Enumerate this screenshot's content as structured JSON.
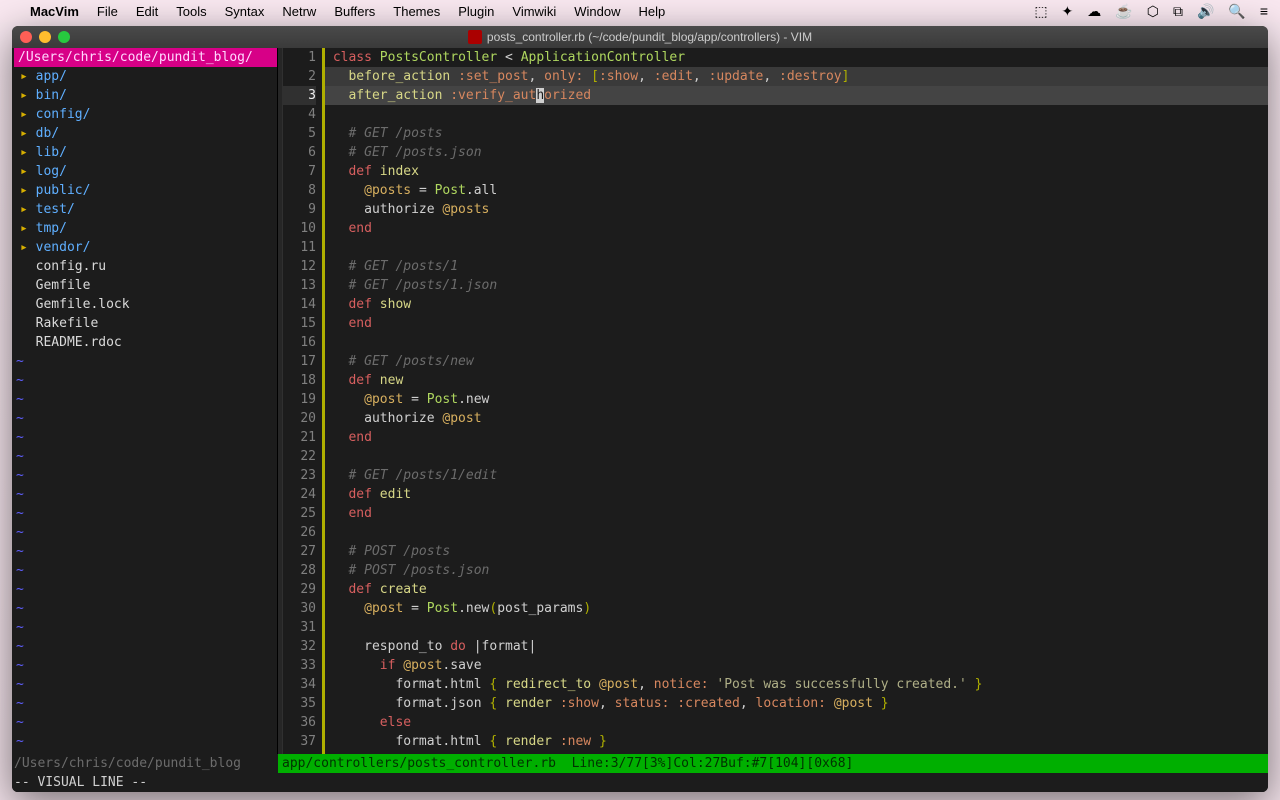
{
  "menubar": {
    "app": "MacVim",
    "items": [
      "File",
      "Edit",
      "Tools",
      "Syntax",
      "Netrw",
      "Buffers",
      "Themes",
      "Plugin",
      "Vimwiki",
      "Window",
      "Help"
    ]
  },
  "window": {
    "title": "posts_controller.rb (~/code/pundit_blog/app/controllers) - VIM"
  },
  "sidebar": {
    "path": "/Users/chris/code/pundit_blog/",
    "dirs": [
      "app/",
      "bin/",
      "config/",
      "db/",
      "lib/",
      "log/",
      "public/",
      "test/",
      "tmp/",
      "vendor/"
    ],
    "files": [
      "config.ru",
      "Gemfile",
      "Gemfile.lock",
      "Rakefile",
      "README.rdoc"
    ]
  },
  "code": {
    "cursor_line": 3,
    "lines": [
      {
        "n": 1,
        "html": " <span class='kw'>class</span> <span class='const'>PostsController</span> <span class='punc'>&lt;</span> <span class='const'>ApplicationController</span>"
      },
      {
        "n": 2,
        "sel": true,
        "html": "   <span class='fn'>before_action</span> <span class='sym'>:set_post</span><span class='punc'>,</span> <span class='sym'>only:</span> <span class='br'>[</span><span class='sym'>:show</span><span class='punc'>,</span> <span class='sym'>:edit</span><span class='punc'>,</span> <span class='sym'>:update</span><span class='punc'>,</span> <span class='sym'>:destroy</span><span class='br'>]</span>"
      },
      {
        "n": 3,
        "sel": true,
        "cur": true,
        "html": "   <span class='fn'>after_action</span> <span class='sym'>:verify_aut<span class='cursor-block'>h</span>orized</span>"
      },
      {
        "n": 4,
        "html": ""
      },
      {
        "n": 5,
        "html": "   <span class='cmt'># GET /posts</span>"
      },
      {
        "n": 6,
        "html": "   <span class='cmt'># GET /posts.json</span>"
      },
      {
        "n": 7,
        "html": "   <span class='kw'>def</span> <span class='fn'>index</span>"
      },
      {
        "n": 8,
        "html": "     <span class='ivar'>@posts</span> <span class='punc'>=</span> <span class='const'>Post</span><span class='punc'>.</span>all"
      },
      {
        "n": 9,
        "html": "     authorize <span class='ivar'>@posts</span>"
      },
      {
        "n": 10,
        "html": "   <span class='kw'>end</span>"
      },
      {
        "n": 11,
        "html": ""
      },
      {
        "n": 12,
        "html": "   <span class='cmt'># GET /posts/1</span>"
      },
      {
        "n": 13,
        "html": "   <span class='cmt'># GET /posts/1.json</span>"
      },
      {
        "n": 14,
        "html": "   <span class='kw'>def</span> <span class='fn'>show</span>"
      },
      {
        "n": 15,
        "html": "   <span class='kw'>end</span>"
      },
      {
        "n": 16,
        "html": ""
      },
      {
        "n": 17,
        "html": "   <span class='cmt'># GET /posts/new</span>"
      },
      {
        "n": 18,
        "html": "   <span class='kw'>def</span> <span class='fn'>new</span>"
      },
      {
        "n": 19,
        "html": "     <span class='ivar'>@post</span> <span class='punc'>=</span> <span class='const'>Post</span><span class='punc'>.</span>new"
      },
      {
        "n": 20,
        "html": "     authorize <span class='ivar'>@post</span>"
      },
      {
        "n": 21,
        "html": "   <span class='kw'>end</span>"
      },
      {
        "n": 22,
        "html": ""
      },
      {
        "n": 23,
        "html": "   <span class='cmt'># GET /posts/1/edit</span>"
      },
      {
        "n": 24,
        "html": "   <span class='kw'>def</span> <span class='fn'>edit</span>"
      },
      {
        "n": 25,
        "html": "   <span class='kw'>end</span>"
      },
      {
        "n": 26,
        "html": ""
      },
      {
        "n": 27,
        "html": "   <span class='cmt'># POST /posts</span>"
      },
      {
        "n": 28,
        "html": "   <span class='cmt'># POST /posts.json</span>"
      },
      {
        "n": 29,
        "html": "   <span class='kw'>def</span> <span class='fn'>create</span>"
      },
      {
        "n": 30,
        "html": "     <span class='ivar'>@post</span> <span class='punc'>=</span> <span class='const'>Post</span><span class='punc'>.</span>new<span class='br'>(</span>post_params<span class='br'>)</span>"
      },
      {
        "n": 31,
        "html": ""
      },
      {
        "n": 32,
        "html": "     respond_to <span class='kw'>do</span> <span class='punc'>|</span>format<span class='punc'>|</span>"
      },
      {
        "n": 33,
        "html": "       <span class='kw'>if</span> <span class='ivar'>@post</span><span class='punc'>.</span>save"
      },
      {
        "n": 34,
        "html": "         format<span class='punc'>.</span>html <span class='br'>{</span> <span class='fn'>redirect_to</span> <span class='ivar'>@post</span><span class='punc'>,</span> <span class='sym'>notice:</span> <span class='str'>'Post was successfully created.'</span> <span class='br'>}</span>"
      },
      {
        "n": 35,
        "html": "         format<span class='punc'>.</span>json <span class='br'>{</span> <span class='fn'>render</span> <span class='sym'>:show</span><span class='punc'>,</span> <span class='sym'>status:</span> <span class='sym'>:created</span><span class='punc'>,</span> <span class='sym'>location:</span> <span class='ivar'>@post</span> <span class='br'>}</span>"
      },
      {
        "n": 36,
        "html": "       <span class='kw'>else</span>"
      },
      {
        "n": 37,
        "html": "         format<span class='punc'>.</span>html <span class='br'>{</span> <span class='fn'>render</span> <span class='sym'>:new</span> <span class='br'>}</span>"
      }
    ]
  },
  "statusline": {
    "left": "/Users/chris/code/pundit_blog",
    "right": "app/controllers/posts_controller.rb  Line:3/77[3%]Col:27Buf:#7[104][0x68]"
  },
  "cmdline": "-- VISUAL LINE --"
}
